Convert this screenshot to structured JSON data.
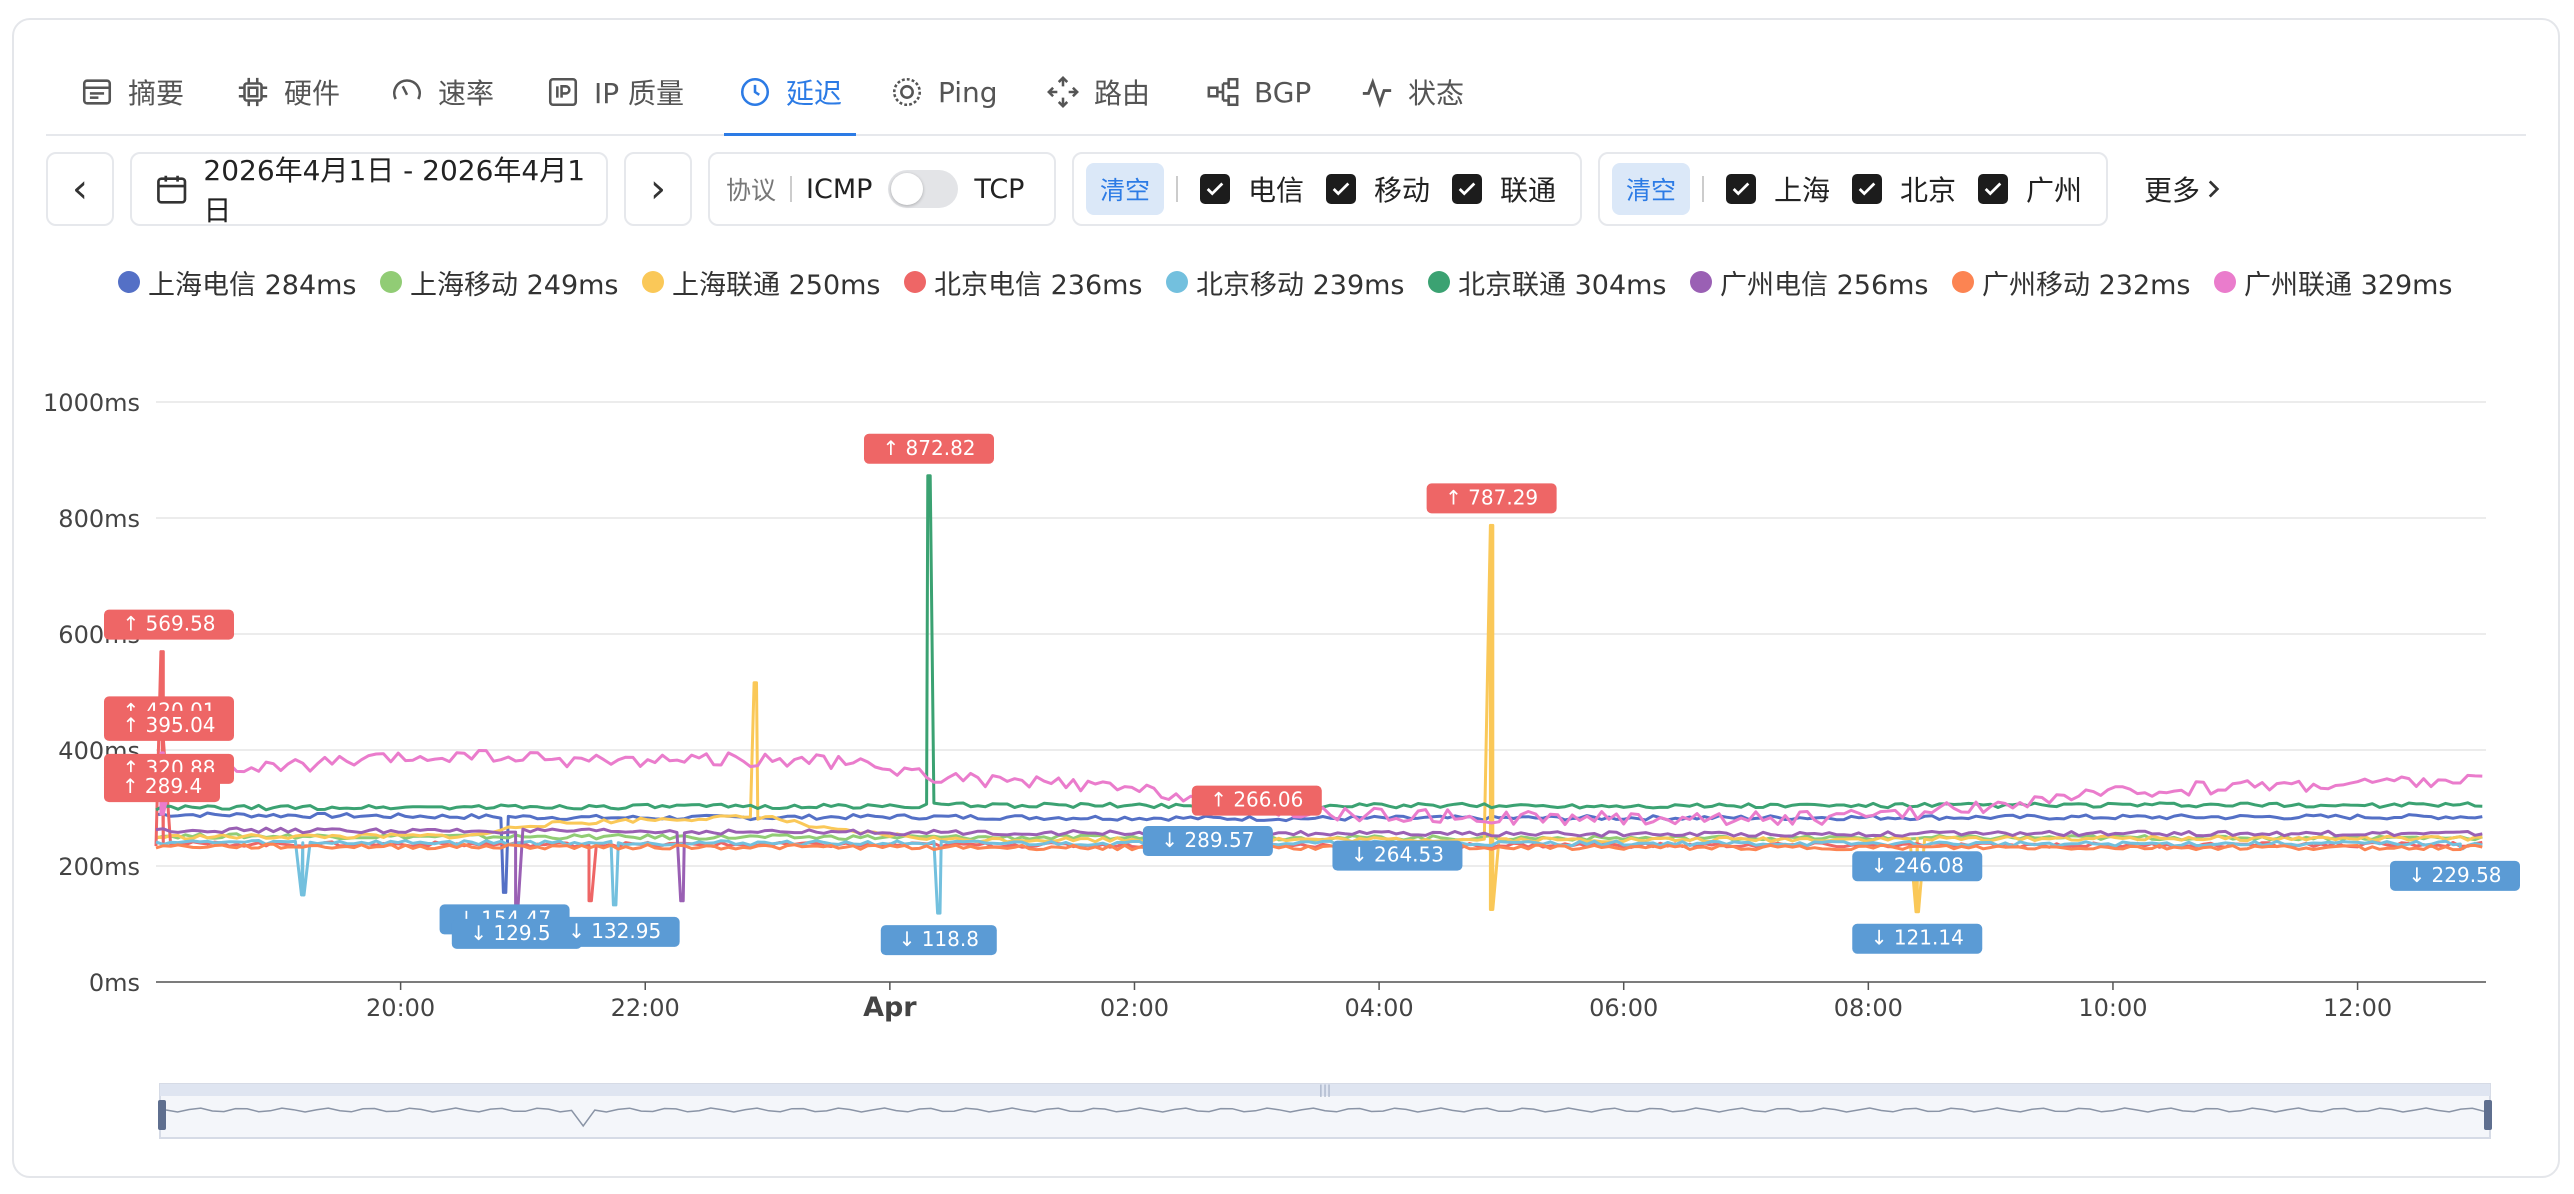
{
  "tabs": [
    {
      "label": "摘要",
      "icon": "summary-icon"
    },
    {
      "label": "硬件",
      "icon": "chip-icon"
    },
    {
      "label": "速率",
      "icon": "gauge-icon"
    },
    {
      "label": "IP 质量",
      "icon": "ip-icon"
    },
    {
      "label": "延迟",
      "icon": "latency-clock-icon",
      "active": true
    },
    {
      "label": "Ping",
      "icon": "globe-icon"
    },
    {
      "label": "路由",
      "icon": "route-icon"
    },
    {
      "label": "BGP",
      "icon": "bgp-icon"
    },
    {
      "label": "状态",
      "icon": "pulse-icon"
    }
  ],
  "toolbar": {
    "prev_label": "‹",
    "next_label": "›",
    "date_range": "2026年4月1日 - 2026年4月1日",
    "protocol_label": "协议",
    "protocol_left": "ICMP",
    "protocol_right": "TCP",
    "protocol_tcp_on": false,
    "isp_clear": "清空",
    "isps": [
      "电信",
      "移动",
      "联通"
    ],
    "city_clear": "清空",
    "cities": [
      "上海",
      "北京",
      "广州"
    ],
    "more_label": "更多"
  },
  "legend": [
    {
      "name": "上海电信",
      "value": "284ms",
      "color": "#5470c6"
    },
    {
      "name": "上海移动",
      "value": "249ms",
      "color": "#91cc75"
    },
    {
      "name": "上海联通",
      "value": "250ms",
      "color": "#fac858"
    },
    {
      "name": "北京电信",
      "value": "236ms",
      "color": "#ee6666"
    },
    {
      "name": "北京移动",
      "value": "239ms",
      "color": "#73c0de"
    },
    {
      "name": "北京联通",
      "value": "304ms",
      "color": "#3ba272"
    },
    {
      "name": "广州电信",
      "value": "256ms",
      "color": "#9a60b4"
    },
    {
      "name": "广州移动",
      "value": "232ms",
      "color": "#fc8452"
    },
    {
      "name": "广州联通",
      "value": "329ms",
      "color": "#ea7ccc"
    }
  ],
  "chart_data": {
    "type": "line",
    "y_ticks": [
      "0ms",
      "200ms",
      "400ms",
      "600ms",
      "800ms",
      "1000ms"
    ],
    "ylim": [
      0,
      1000
    ],
    "x_ticks": [
      "20:00",
      "22:00",
      "Apr",
      "02:00",
      "04:00",
      "06:00",
      "08:00",
      "10:00",
      "12:00"
    ],
    "x_tick_hours": [
      20,
      22,
      24,
      26,
      28,
      30,
      32,
      34,
      36
    ],
    "xlim_hours": [
      18.0,
      37.05
    ],
    "grid": true,
    "series": [
      {
        "name": "上海电信",
        "color": "#5470c6",
        "points": [
          [
            18.0,
            289
          ],
          [
            20.0,
            286
          ],
          [
            22.0,
            283
          ],
          [
            24.0,
            285
          ],
          [
            25.0,
            284
          ],
          [
            27.0,
            282
          ],
          [
            30.0,
            283
          ],
          [
            33.0,
            284
          ],
          [
            37.05,
            285
          ]
        ],
        "spikes": [
          [
            20.85,
            154.47
          ]
        ]
      },
      {
        "name": "上海移动",
        "color": "#91cc75",
        "points": [
          [
            18.0,
            252
          ],
          [
            22.0,
            250
          ],
          [
            26.0,
            249
          ],
          [
            30.0,
            248
          ],
          [
            34.0,
            249
          ],
          [
            37.05,
            249
          ]
        ]
      },
      {
        "name": "上海联通",
        "color": "#fac858",
        "points": [
          [
            18.0,
            250
          ],
          [
            20.6,
            252
          ],
          [
            21.0,
            270
          ],
          [
            22.0,
            280
          ],
          [
            23.0,
            285
          ],
          [
            23.5,
            262
          ],
          [
            24.5,
            245
          ],
          [
            26.0,
            246
          ],
          [
            30.0,
            245
          ],
          [
            34.0,
            248
          ],
          [
            37.05,
            247
          ]
        ],
        "spikes": [
          [
            22.9,
            516
          ],
          [
            28.92,
            787.29
          ],
          [
            28.92,
            125
          ],
          [
            32.4,
            121.14
          ]
        ]
      },
      {
        "name": "北京电信",
        "color": "#ee6666",
        "points": [
          [
            18.0,
            238
          ],
          [
            22.0,
            237
          ],
          [
            26.0,
            236
          ],
          [
            30.0,
            236
          ],
          [
            34.0,
            236
          ],
          [
            37.05,
            237
          ]
        ],
        "spikes": [
          [
            18.05,
            569.58
          ],
          [
            18.05,
            420.01
          ],
          [
            21.55,
            140
          ],
          [
            27.0,
            266.06
          ]
        ]
      },
      {
        "name": "北京移动",
        "color": "#73c0de",
        "points": [
          [
            18.0,
            241
          ],
          [
            22.0,
            240
          ],
          [
            26.0,
            239
          ],
          [
            30.0,
            239
          ],
          [
            34.0,
            238
          ],
          [
            37.05,
            239
          ]
        ],
        "spikes": [
          [
            19.2,
            150
          ],
          [
            21.75,
            132.95
          ],
          [
            24.4,
            118.8
          ],
          [
            36.85,
            229.58
          ]
        ]
      },
      {
        "name": "北京联通",
        "color": "#3ba272",
        "points": [
          [
            18.0,
            300
          ],
          [
            21.0,
            302
          ],
          [
            24.0,
            303
          ],
          [
            24.35,
            305
          ],
          [
            27.0,
            304
          ],
          [
            31.0,
            304
          ],
          [
            34.0,
            305
          ],
          [
            37.05,
            305
          ]
        ],
        "spikes": [
          [
            24.32,
            872.82
          ]
        ]
      },
      {
        "name": "广州电信",
        "color": "#9a60b4",
        "points": [
          [
            18.0,
            262
          ],
          [
            21.0,
            260
          ],
          [
            24.0,
            258
          ],
          [
            27.0,
            256
          ],
          [
            30.0,
            255
          ],
          [
            34.0,
            256
          ],
          [
            37.05,
            256
          ]
        ],
        "spikes": [
          [
            20.95,
            129.51
          ],
          [
            22.3,
            140
          ]
        ]
      },
      {
        "name": "广州移动",
        "color": "#fc8452",
        "points": [
          [
            18.0,
            234
          ],
          [
            22.0,
            233
          ],
          [
            26.0,
            232
          ],
          [
            30.0,
            232
          ],
          [
            34.0,
            232
          ],
          [
            37.05,
            232
          ]
        ]
      },
      {
        "name": "广州联通",
        "color": "#ea7ccc",
        "points": [
          [
            18.0,
            330
          ],
          [
            18.6,
            365
          ],
          [
            19.5,
            378
          ],
          [
            20.5,
            390
          ],
          [
            21.5,
            382
          ],
          [
            22.5,
            385
          ],
          [
            23.5,
            380
          ],
          [
            24.0,
            368
          ],
          [
            24.5,
            350
          ],
          [
            25.5,
            340
          ],
          [
            26.5,
            320
          ],
          [
            27.0,
            300
          ],
          [
            27.5,
            290
          ],
          [
            29.0,
            283
          ],
          [
            31.0,
            282
          ],
          [
            32.0,
            285
          ],
          [
            33.0,
            305
          ],
          [
            34.0,
            325
          ],
          [
            35.0,
            338
          ],
          [
            36.0,
            342
          ],
          [
            37.05,
            350
          ]
        ],
        "spikes": [
          [
            18.05,
            395.04
          ],
          [
            18.05,
            289.4
          ]
        ]
      }
    ],
    "max_markers": [
      {
        "label": "↑ 872.82",
        "value": 872.82,
        "x": 24.32,
        "color": "#ee6666"
      },
      {
        "label": "↑ 787.29",
        "value": 787.29,
        "x": 28.92,
        "color": "#ee6666"
      },
      {
        "label": "↑ 569.58",
        "value": 569.58,
        "x": 18.0,
        "color": "#ee6666"
      },
      {
        "label": "↑ 420.01",
        "value": 420.01,
        "x": 18.0,
        "color": "#ee6666"
      },
      {
        "label": "↑ 395.04",
        "value": 395.04,
        "x": 18.0,
        "color": "#ee6666"
      },
      {
        "label": "↑ 320.88",
        "value": 320.88,
        "x": 18.0,
        "color": "#ee6666"
      },
      {
        "label": "↑ 289.4",
        "value": 289.4,
        "x": 18.0,
        "color": "#ee6666"
      },
      {
        "label": "↑ 266.06",
        "value": 266.06,
        "x": 27.0,
        "color": "#ee6666"
      }
    ],
    "min_markers": [
      {
        "label": "↓ 154.47",
        "value": 154.47,
        "x": 20.85,
        "color": "#5b9bd5"
      },
      {
        "label": "↓ 129.51",
        "value": 129.51,
        "x": 20.95,
        "color": "#5b9bd5"
      },
      {
        "label": "↓ 132.95",
        "value": 132.95,
        "x": 21.75,
        "color": "#5b9bd5"
      },
      {
        "label": "↓ 118.8",
        "value": 118.8,
        "x": 24.4,
        "color": "#5b9bd5"
      },
      {
        "label": "↓ 289.57",
        "value": 289.57,
        "x": 26.6,
        "color": "#5b9bd5"
      },
      {
        "label": "↓ 264.53",
        "value": 264.53,
        "x": 28.15,
        "color": "#5b9bd5"
      },
      {
        "label": "↓ 246.08",
        "value": 246.08,
        "x": 32.4,
        "color": "#5b9bd5"
      },
      {
        "label": "↓ 121.14",
        "value": 121.14,
        "x": 32.4,
        "color": "#5b9bd5"
      },
      {
        "label": "↓ 229.58",
        "value": 229.58,
        "x": 36.85,
        "color": "#5b9bd5"
      }
    ],
    "zoom_range": [
      0,
      100
    ]
  }
}
